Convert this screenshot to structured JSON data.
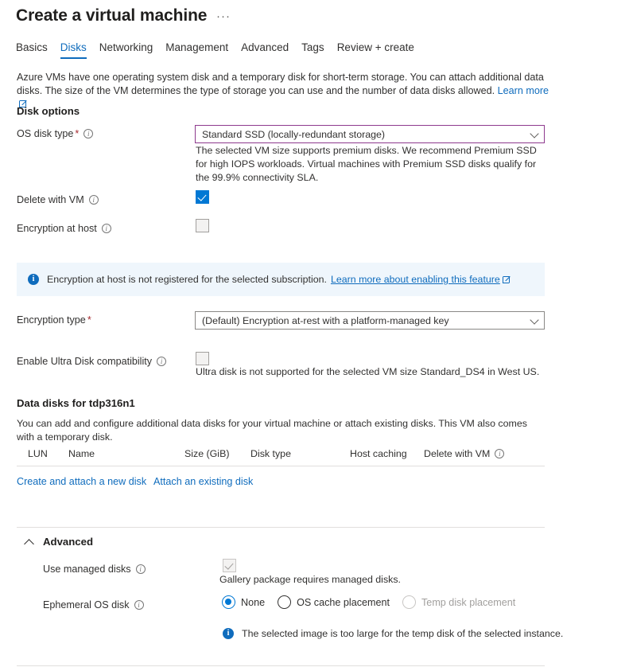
{
  "header": {
    "title": "Create a virtual machine",
    "more_actions": "···"
  },
  "tabs": [
    {
      "label": "Basics",
      "active": false
    },
    {
      "label": "Disks",
      "active": true
    },
    {
      "label": "Networking",
      "active": false
    },
    {
      "label": "Management",
      "active": false
    },
    {
      "label": "Advanced",
      "active": false
    },
    {
      "label": "Tags",
      "active": false
    },
    {
      "label": "Review + create",
      "active": false
    }
  ],
  "intro": {
    "line1": "Azure VMs have one operating system disk and a temporary disk for short-term storage. You can attach additional data disks.",
    "line2": "The size of the VM determines the type of storage you can use and the number of data disks allowed.",
    "learn_more": "Learn more"
  },
  "disk_options": {
    "heading": "Disk options",
    "os_disk_type": {
      "label": "OS disk type",
      "required": "*",
      "value": "Standard SSD (locally-redundant storage)",
      "help": "The selected VM size supports premium disks. We recommend Premium SSD for high IOPS workloads. Virtual machines with Premium SSD disks qualify for the 99.9% connectivity SLA."
    },
    "delete_with_vm": {
      "label": "Delete with VM",
      "checked": true
    },
    "encryption_at_host": {
      "label": "Encryption at host",
      "checked": false
    },
    "banner": {
      "text": "Encryption at host is not registered for the selected subscription.",
      "link": "Learn more about enabling this feature"
    },
    "encryption_type": {
      "label": "Encryption type",
      "required": "*",
      "value": "(Default) Encryption at-rest with a platform-managed key"
    },
    "ultra_disk": {
      "label": "Enable Ultra Disk compatibility",
      "checked": false,
      "note": "Ultra disk is not supported for the selected VM size Standard_DS4 in West US."
    }
  },
  "data_disks": {
    "heading": "Data disks for tdp316n1",
    "description": "You can add and configure additional data disks for your virtual machine or attach existing disks. This VM also comes with a temporary disk.",
    "columns": [
      "LUN",
      "Name",
      "Size (GiB)",
      "Disk type",
      "Host caching",
      "Delete with VM"
    ],
    "rows": [],
    "actions": {
      "create_new": "Create and attach a new disk",
      "attach_existing": "Attach an existing disk"
    }
  },
  "advanced": {
    "heading": "Advanced",
    "expanded": true,
    "use_managed_disks": {
      "label": "Use managed disks",
      "checked": true,
      "disabled": true,
      "note": "Gallery package requires managed disks."
    },
    "ephemeral_os_disk": {
      "label": "Ephemeral OS disk",
      "options": [
        {
          "label": "None",
          "selected": true,
          "disabled": false
        },
        {
          "label": "OS cache placement",
          "selected": false,
          "disabled": false
        },
        {
          "label": "Temp disk placement",
          "selected": false,
          "disabled": true
        }
      ],
      "note": "The selected image is too large for the temp disk of the selected instance."
    }
  },
  "colors": {
    "accent": "#0078d4",
    "link": "#0f6cbd",
    "required": "#a4262c",
    "banner_bg": "#eff6fc",
    "focus_border": "#8e3a8e"
  }
}
